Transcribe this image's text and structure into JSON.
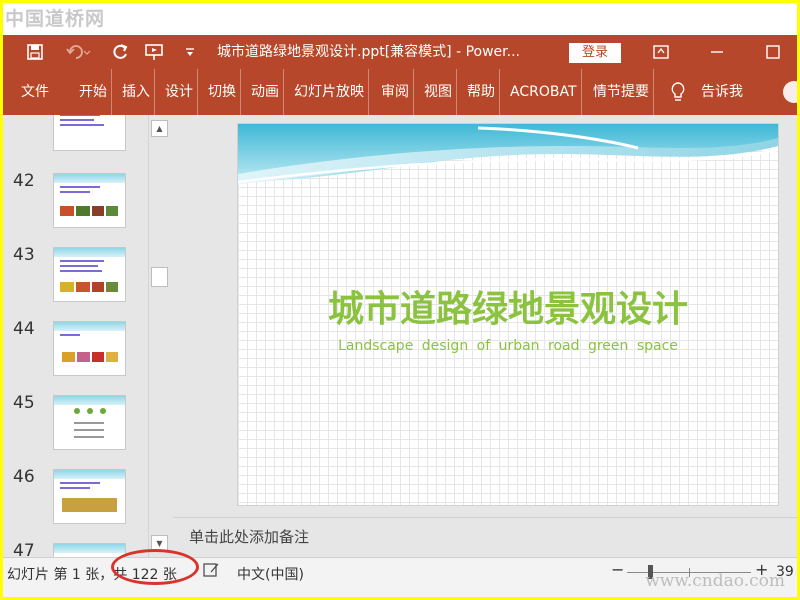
{
  "watermark": {
    "top": "中国道桥网",
    "bottom": "www.cndao.com"
  },
  "titlebar": {
    "document_title": "城市道路绿地景观设计.ppt[兼容模式]  -  Power...",
    "login_label": "登录",
    "icons": [
      "save-icon",
      "undo-icon",
      "redo-icon",
      "present-icon",
      "customize-icon",
      "ribbon-display-icon",
      "minimize-icon",
      "maximize-icon"
    ]
  },
  "menu": {
    "tabs": [
      "文件",
      "开始",
      "插入",
      "设计",
      "切换",
      "动画",
      "幻灯片放映",
      "审阅",
      "视图",
      "帮助",
      "ACROBAT",
      "情节提要"
    ],
    "tell_me": "告诉我"
  },
  "thumbnails": {
    "numbers": [
      "42",
      "43",
      "44",
      "45",
      "46",
      "47"
    ]
  },
  "slide": {
    "title": "城市道路绿地景观设计",
    "subtitle": "Landscape design of urban road green space",
    "accent_color": "#8bc340"
  },
  "notes": {
    "placeholder": "单击此处添加备注"
  },
  "status": {
    "slide_info": "幻灯片 第 1 张，共 122 张",
    "language": "中文(中国)",
    "zoom": "39"
  },
  "colors": {
    "ribbon": "#b7472a",
    "highlight_circle": "#d9342b"
  }
}
